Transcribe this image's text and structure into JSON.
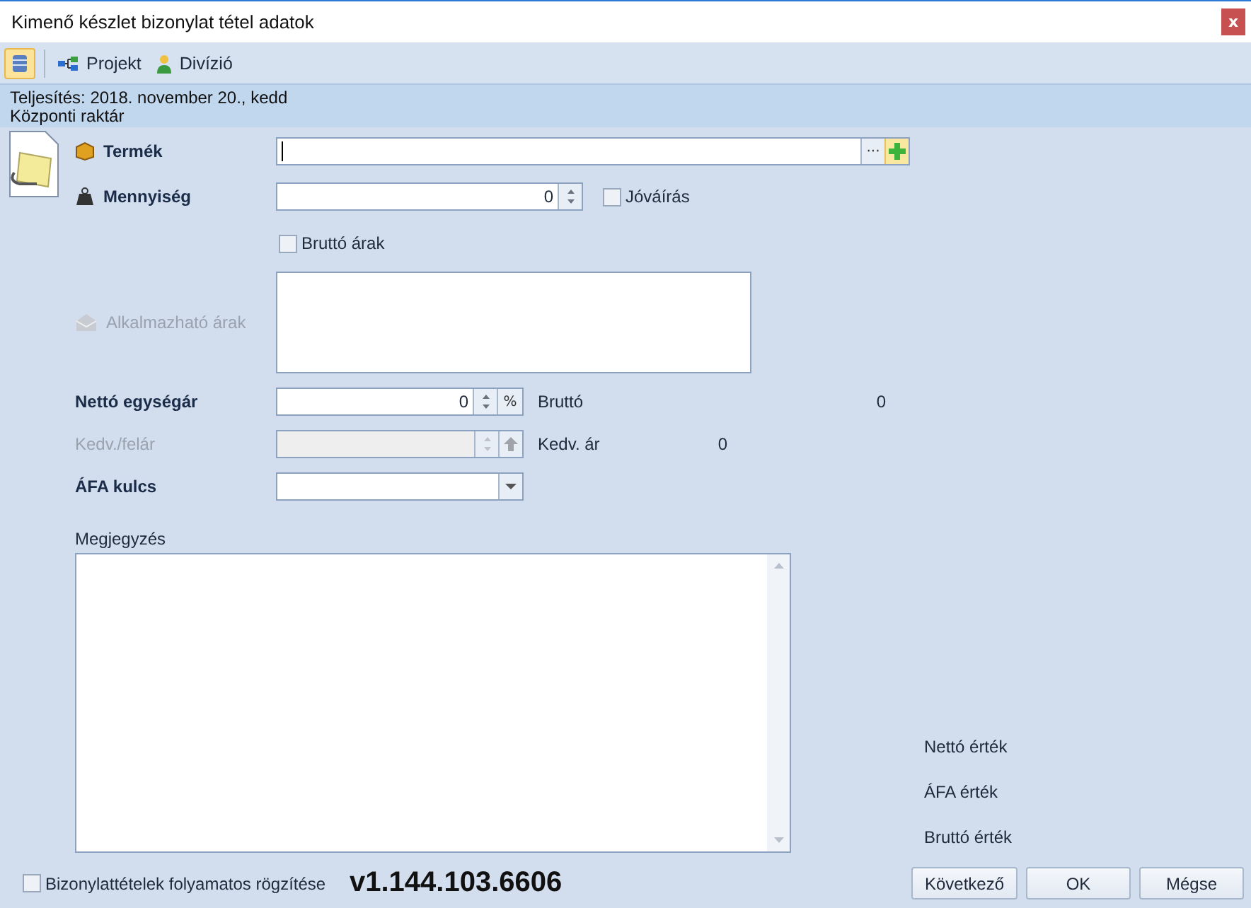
{
  "window": {
    "title": "Kimenő készlet bizonylat tétel adatok",
    "close": "x"
  },
  "toolbar": [
    {
      "kind": "icon",
      "selected": true
    },
    {
      "kind": "text",
      "label": "Projekt",
      "selected": false
    },
    {
      "kind": "text",
      "label": "Divízió",
      "selected": false
    }
  ],
  "info": [
    "Teljesítés: 2018. november 20., kedd",
    "Központi raktár"
  ],
  "product": {
    "label": "Termék",
    "browse": "···"
  },
  "quantity": {
    "label": "Mennyiség",
    "value": "0"
  },
  "credit": {
    "label": "Jóváírás",
    "checked": false
  },
  "gross_prices": {
    "label": "Bruttó árak",
    "checked": false
  },
  "applicable_prices": {
    "label": "Alkalmazható árak",
    "disabled": true
  },
  "net_unit_price": {
    "label": "Nettó egységár",
    "value": "0",
    "percent": "%"
  },
  "gross": {
    "label": "Bruttó",
    "value": "0"
  },
  "discount": {
    "label": "Kedv./felár",
    "disabled": true
  },
  "discount_price": {
    "label": "Kedv. ár",
    "value": "0"
  },
  "vat": {
    "label": "ÁFA kulcs"
  },
  "note": {
    "label": "Megjegyzés"
  },
  "totals": [
    "Nettó érték",
    "ÁFA érték",
    "Bruttó érték"
  ],
  "continuous": {
    "label": "Bizonylattételek folyamatos rögzítése",
    "checked": false
  },
  "version": "v1.144.103.6606",
  "buttons": [
    "Következő",
    "OK",
    "Mégse"
  ]
}
